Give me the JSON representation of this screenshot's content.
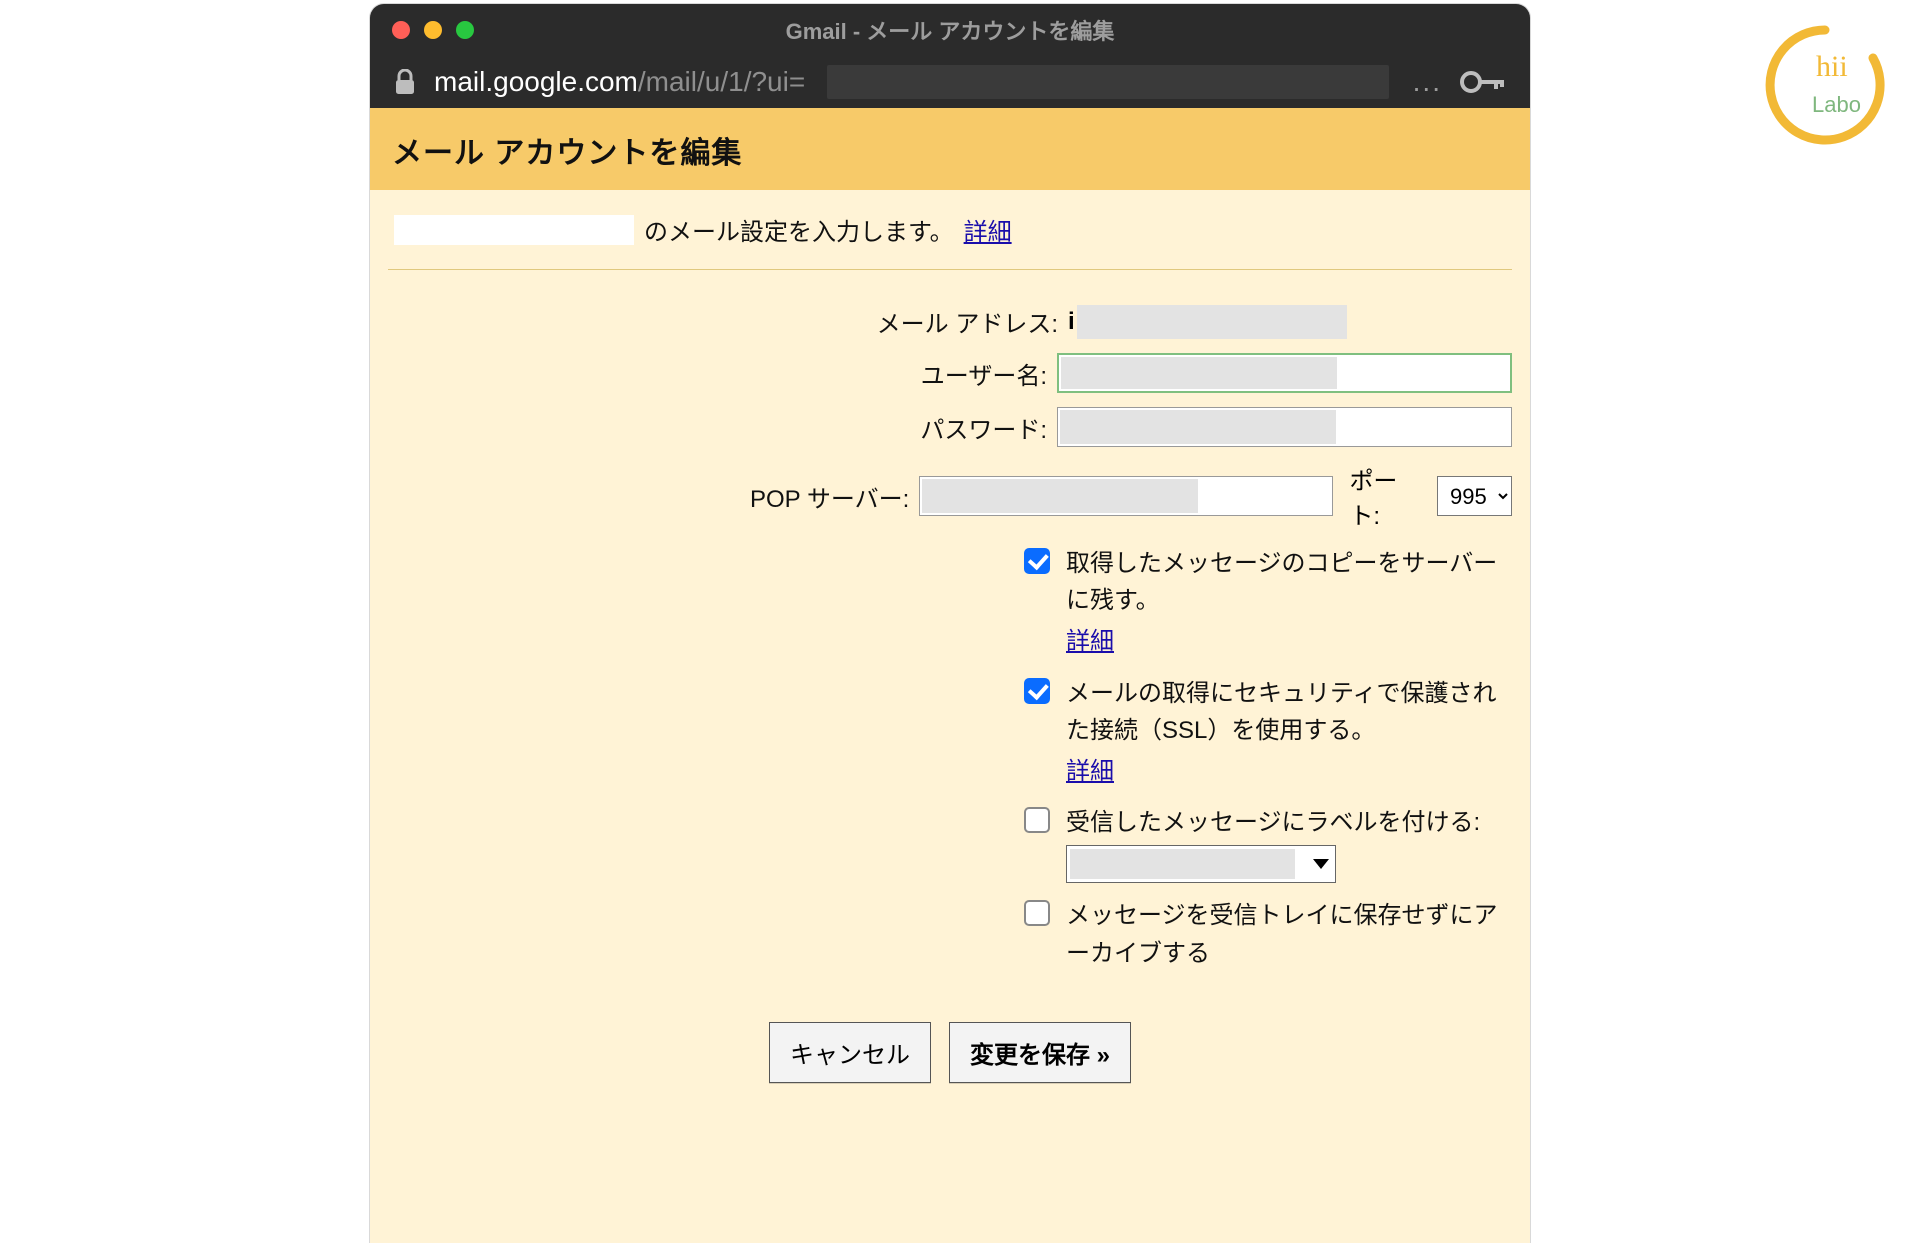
{
  "window": {
    "title": "Gmail - メール アカウントを編集",
    "traffic_colors": {
      "close": "#ff5f57",
      "min": "#febc2e",
      "max": "#28c840"
    }
  },
  "address": {
    "host": "mail.google.com",
    "path": "/mail/u/1/?ui=",
    "ellipsis": "..."
  },
  "page": {
    "heading": "メール アカウントを編集",
    "lead_suffix": "のメール設定を入力します。",
    "details": "詳細"
  },
  "form": {
    "email_label": "メール アドレス:",
    "email_prefix": "i",
    "username_label": "ユーザー名:",
    "password_label": "パスワード:",
    "pop_label": "POP サーバー:",
    "port_label": "ポート:",
    "port_value": "995",
    "opt_keep_copy": "取得したメッセージのコピーをサーバーに残す。",
    "opt_keep_copy_checked": true,
    "opt_ssl": "メールの取得にセキュリティで保護された接続（SSL）を使用する。",
    "opt_ssl_checked": true,
    "opt_label": "受信したメッセージにラベルを付ける:",
    "opt_label_checked": false,
    "opt_archive": "メッセージを受信トレイに保存せずにアーカイブする",
    "opt_archive_checked": false
  },
  "buttons": {
    "cancel": "キャンセル",
    "save": "変更を保存 »"
  },
  "logo": {
    "text_top": "hii",
    "text_bottom": "Labo"
  }
}
